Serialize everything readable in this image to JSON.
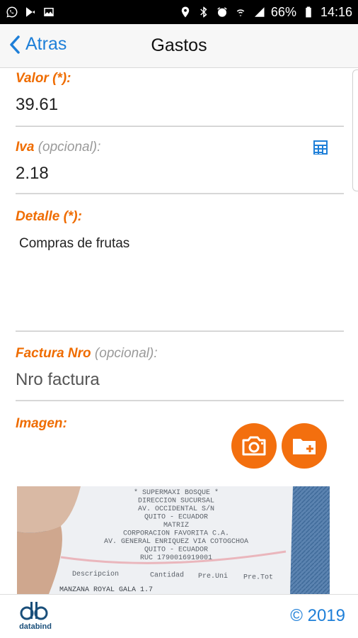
{
  "status_bar": {
    "battery": "66%",
    "time": "14:16"
  },
  "app_bar": {
    "back_label": "Atras",
    "title": "Gastos"
  },
  "form": {
    "valor": {
      "label": "Valor (*):",
      "value": "39.61"
    },
    "iva": {
      "label": "Iva",
      "label_optional": "(opcional):",
      "value": "2.18"
    },
    "detalle": {
      "label": "Detalle (*):",
      "value": "Compras de frutas"
    },
    "factura": {
      "label": "Factura Nro",
      "label_optional": "(opcional):",
      "placeholder": "Nro factura"
    },
    "imagen": {
      "label": "Imagen:"
    }
  },
  "receipt_photo": {
    "lines": [
      "* SUPERMAXI BOSQUE *",
      "DIRECCION SUCURSAL",
      "AV. OCCIDENTAL S/N",
      "QUITO - ECUADOR",
      "MATRIZ",
      "CORPORACION FAVORITA C.A.",
      "AV. GENERAL ENRIQUEZ VIA COTOGCHOA",
      "QUITO - ECUADOR",
      "RUC 1790016919001"
    ],
    "columns": [
      "Descripcion",
      "Cantidad",
      "Pre.Uni",
      "Pre.Tot"
    ],
    "first_item": "MANZANA ROYAL GALA  1.7"
  },
  "footer": {
    "logo_text": "databind",
    "copyright": "© 2019"
  },
  "colors": {
    "accent_orange": "#ef6c00",
    "link_blue": "#1e7fd8",
    "button_orange": "#f36f0e"
  }
}
